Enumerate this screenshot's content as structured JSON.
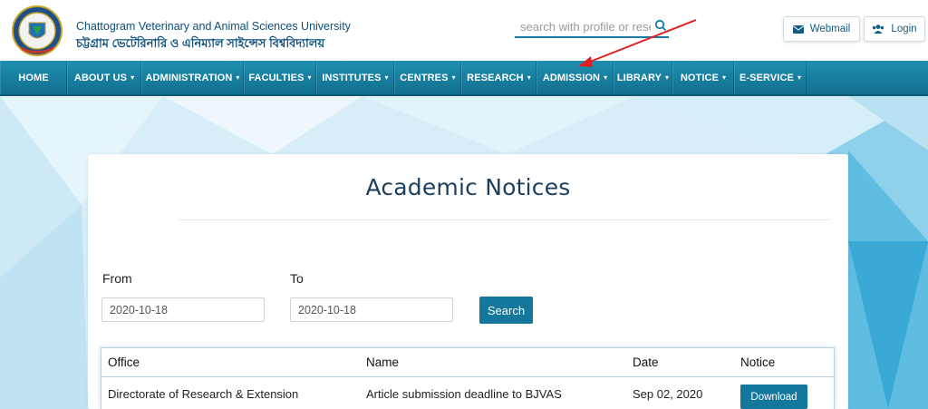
{
  "header": {
    "university_en": "Chattogram Veterinary and Animal Sciences University",
    "university_bn": "চট্টগ্রাম ভেটেরিনারি ও এনিম্যাল সাইন্সেস বিশ্ববিদ্যালয়",
    "logo_icon": "university-crest-icon",
    "search": {
      "placeholder": "search with profile or research"
    },
    "buttons": [
      {
        "label": "Webmail",
        "icon": "envelope-icon"
      },
      {
        "label": "Login",
        "icon": "users-icon"
      }
    ]
  },
  "nav": {
    "items": [
      {
        "label": "HOME",
        "caret": ""
      },
      {
        "label": "ABOUT US",
        "caret": "▾"
      },
      {
        "label": "ADMINISTRATION",
        "caret": "▾"
      },
      {
        "label": "FACULTIES",
        "caret": "▾"
      },
      {
        "label": "INSTITUTES",
        "caret": "▾"
      },
      {
        "label": "CENTRES",
        "caret": "▾"
      },
      {
        "label": "RESEARCH",
        "caret": "▾"
      },
      {
        "label": "ADMISSION",
        "caret": "▾"
      },
      {
        "label": "LIBRARY",
        "caret": "▾"
      },
      {
        "label": "NOTICE",
        "caret": "▾"
      },
      {
        "label": "E-SERVICE",
        "caret": "▾"
      }
    ]
  },
  "notices": {
    "title": "Academic Notices",
    "from_label": "From",
    "to_label": "To",
    "from_value": "2020-10-18",
    "to_value": "2020-10-18",
    "search_label": "Search",
    "columns": [
      "Office",
      "Name",
      "Date",
      "Notice"
    ],
    "rows": [
      {
        "office": "Directorate of Research & Extension",
        "name": "Article submission deadline to BJVAS",
        "date": "Sep 02, 2020",
        "action": "Download"
      }
    ]
  },
  "colors": {
    "brand": "#0b4f7a",
    "nav": "#1d8fb0",
    "button": "#14779c",
    "annotation": "#e02020"
  }
}
